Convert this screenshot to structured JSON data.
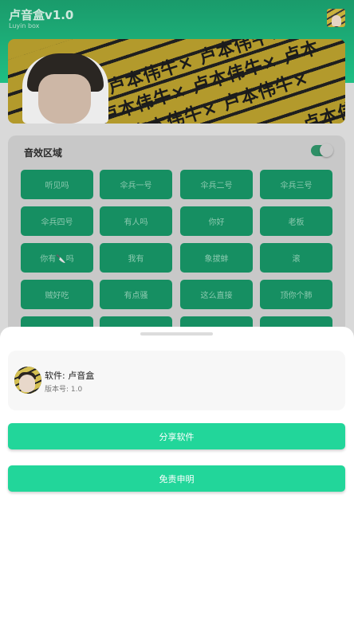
{
  "header": {
    "title": "卢音盒v1.0",
    "subtitle": "Luyin box"
  },
  "banner": {
    "lines": [
      "卢本伟牛× 卢本伟牛×",
      "卢本伟牛× 卢本伟牛× 卢本",
      "卢本伟牛× 卢本伟牛×",
      "卢本伟牛× 卢本伟牛×"
    ]
  },
  "sound_panel": {
    "title": "音效区域",
    "toggle_on": true,
    "buttons": [
      [
        "听见吗",
        "伞兵一号",
        "伞兵二号",
        "伞兵三号"
      ],
      [
        "伞兵四号",
        "有人吗",
        "你好",
        "老板"
      ],
      [
        "你有🔪吗",
        "我有",
        "象拔蚌",
        "滚"
      ],
      [
        "贼好吃",
        "有点骚",
        "这么直接",
        "顶你个肺"
      ]
    ]
  },
  "sheet": {
    "software_label": "软件: 卢音盒",
    "version_label": "版本号: 1.0",
    "share_button": "分享软件",
    "disclaimer_button": "免责申明"
  },
  "colors": {
    "accent": "#22d69a",
    "header": "#1fbf84",
    "sound_button": "#168f62"
  }
}
